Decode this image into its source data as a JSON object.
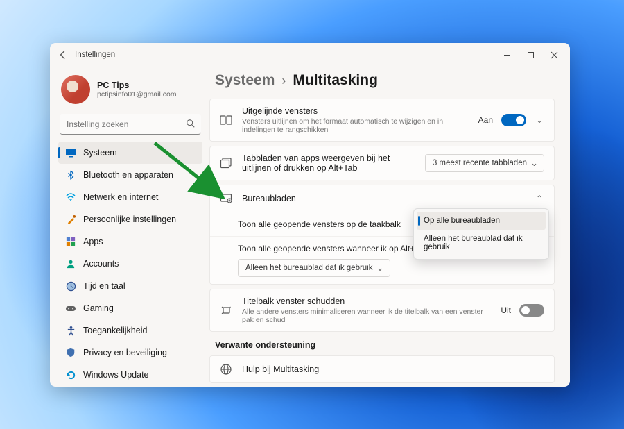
{
  "app_title": "Instellingen",
  "profile": {
    "name": "PC Tips",
    "email": "pctipsinfo01@gmail.com"
  },
  "search": {
    "placeholder": "Instelling zoeken"
  },
  "sidebar": {
    "items": [
      {
        "label": "Systeem"
      },
      {
        "label": "Bluetooth en apparaten"
      },
      {
        "label": "Netwerk en internet"
      },
      {
        "label": "Persoonlijke instellingen"
      },
      {
        "label": "Apps"
      },
      {
        "label": "Accounts"
      },
      {
        "label": "Tijd en taal"
      },
      {
        "label": "Gaming"
      },
      {
        "label": "Toegankelijkheid"
      },
      {
        "label": "Privacy en beveiliging"
      },
      {
        "label": "Windows Update"
      }
    ]
  },
  "breadcrumb": {
    "parent": "Systeem",
    "current": "Multitasking"
  },
  "cards": {
    "snap": {
      "title": "Uitgelijnde vensters",
      "subtitle": "Vensters uitlijnen om het formaat automatisch te wijzigen en in indelingen te rangschikken",
      "state_label": "Aan"
    },
    "alttab_tabs": {
      "title": "Tabbladen van apps weergeven bij het uitlijnen of drukken op Alt+Tab",
      "value": "3 meest recente tabbladen"
    },
    "desktops": {
      "title": "Bureaubladen",
      "row1": "Toon alle geopende vensters op de taakbalk",
      "row2": "Toon alle geopende vensters wanneer ik op Alt+Tab druk",
      "select_value": "Alleen het bureaublad dat ik gebruik"
    },
    "shake": {
      "title": "Titelbalk venster schudden",
      "subtitle": "Alle andere vensters minimaliseren wanneer ik de titelbalk van een venster pak en schud",
      "state_label": "Uit"
    }
  },
  "dropdown": {
    "opt1": "Op alle bureaubladen",
    "opt2": "Alleen het bureaublad dat ik gebruik"
  },
  "related": {
    "heading": "Verwante ondersteuning",
    "help": "Hulp bij Multitasking"
  }
}
